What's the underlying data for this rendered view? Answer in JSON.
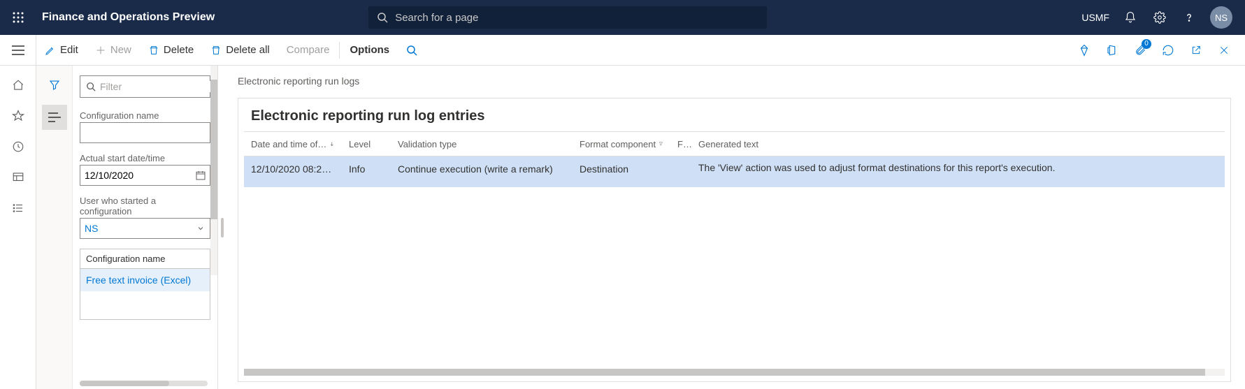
{
  "header": {
    "title": "Finance and Operations Preview",
    "search_placeholder": "Search for a page",
    "company": "USMF",
    "avatar_initials": "NS"
  },
  "toolbar": {
    "edit": "Edit",
    "new": "New",
    "delete": "Delete",
    "delete_all": "Delete all",
    "compare": "Compare",
    "options": "Options",
    "attach_badge": "0"
  },
  "sidepanel": {
    "filter_placeholder": "Filter",
    "config_name_label": "Configuration name",
    "config_name_value": "",
    "start_date_label": "Actual start date/time",
    "start_date_value": "12/10/2020",
    "user_label": "User who started a configuration",
    "user_value": "NS",
    "mini_table_header": "Configuration name",
    "mini_table_row": "Free text invoice (Excel)"
  },
  "content": {
    "breadcrumb": "Electronic reporting run logs",
    "card_title": "Electronic reporting run log entries",
    "columns": {
      "date": "Date and time of…",
      "level": "Level",
      "vtype": "Validation type",
      "fcomp": "Format component",
      "short": "F…",
      "gen": "Generated text"
    },
    "rows": [
      {
        "date": "12/10/2020 08:2…",
        "level": "Info",
        "vtype": "Continue execution (write a remark)",
        "fcomp": "Destination",
        "short": "",
        "gen": "The 'View' action was used to adjust format destinations for this report's execution."
      }
    ]
  }
}
